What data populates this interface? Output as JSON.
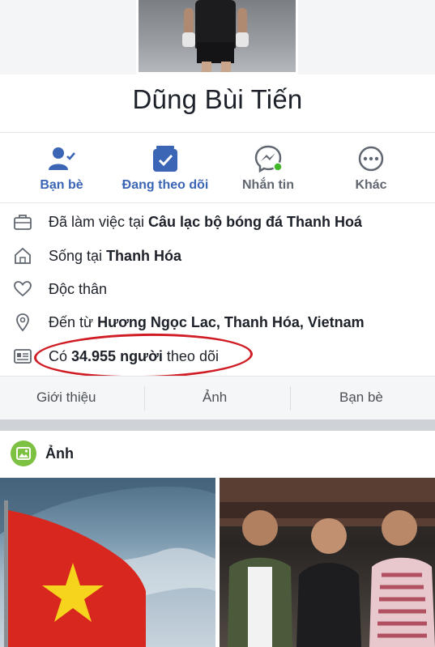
{
  "profile": {
    "name": "Dũng Bùi Tiến",
    "photo_icon": "profile-photo"
  },
  "actions": [
    {
      "label": "Bạn bè",
      "icon": "friends-icon"
    },
    {
      "label": "Đang theo dõi",
      "icon": "following-icon"
    },
    {
      "label": "Nhắn tin",
      "icon": "messenger-icon"
    },
    {
      "label": "Khác",
      "icon": "more-icon"
    }
  ],
  "info": {
    "work": {
      "prefix": "Đã làm việc tại ",
      "value": "Câu lạc bộ bóng đá Thanh Hoá",
      "icon": "briefcase-icon"
    },
    "lives": {
      "prefix": "Sống tại ",
      "value": "Thanh Hóa",
      "icon": "home-icon"
    },
    "relationship": {
      "value": "Độc thân",
      "icon": "heart-icon"
    },
    "from": {
      "prefix": "Đến từ ",
      "value": "Hương Ngọc Lac, Thanh Hóa, Vietnam",
      "icon": "location-pin-icon"
    },
    "followers": {
      "prefix": "Có ",
      "count": "34.955 người",
      "suffix": " theo dõi",
      "icon": "id-card-icon"
    }
  },
  "tabs": [
    {
      "label": "Giới thiệu"
    },
    {
      "label": "Ảnh"
    },
    {
      "label": "Bạn bè"
    }
  ],
  "photos": {
    "title": "Ảnh",
    "icon": "photos-icon"
  },
  "colors": {
    "accent": "#3b65b5",
    "highlight": "#d01c24",
    "online": "#42b72a"
  }
}
